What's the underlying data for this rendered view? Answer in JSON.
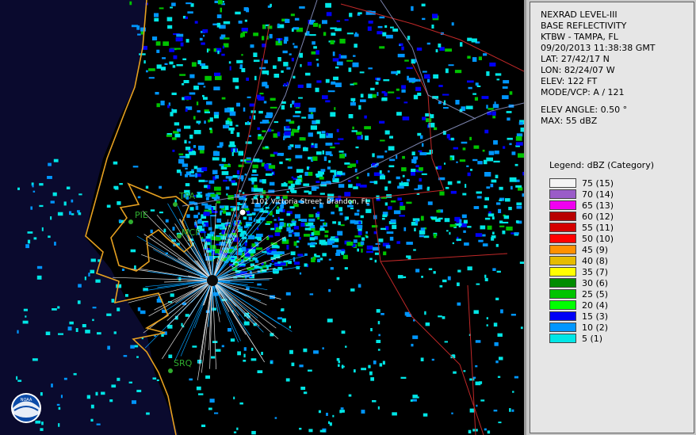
{
  "info": {
    "product": "NEXRAD LEVEL-III",
    "type": "BASE REFLECTIVITY",
    "station": "KTBW - TAMPA, FL",
    "datetime": "09/20/2013 11:38:38 GMT",
    "lat": "LAT: 27/42/17 N",
    "lon": "LON: 82/24/07 W",
    "elev": "ELEV: 122 FT",
    "mode": "MODE/VCP: A / 121",
    "elev_angle": "ELEV ANGLE: 0.50 °",
    "max": "MAX: 55 dBZ"
  },
  "legend": {
    "title": "Legend: dBZ (Category)",
    "items": [
      {
        "label": "75  (15)",
        "color": "#f4f4f4"
      },
      {
        "label": "70  (14)",
        "color": "#9a5cc8"
      },
      {
        "label": "65  (13)",
        "color": "#f000f0"
      },
      {
        "label": "60  (12)",
        "color": "#b80000"
      },
      {
        "label": "55  (11)",
        "color": "#d40000"
      },
      {
        "label": "50  (10)",
        "color": "#ff0000"
      },
      {
        "label": "45  (9)",
        "color": "#ff9000"
      },
      {
        "label": "40  (8)",
        "color": "#e6bc00"
      },
      {
        "label": "35  (7)",
        "color": "#ffff00"
      },
      {
        "label": "30  (6)",
        "color": "#008c00"
      },
      {
        "label": "25  (5)",
        "color": "#00c400"
      },
      {
        "label": "20  (4)",
        "color": "#00ff00"
      },
      {
        "label": "15  (3)",
        "color": "#0000f6"
      },
      {
        "label": "10  (2)",
        "color": "#0096ff"
      },
      {
        "label": "5  (1)",
        "color": "#00e6e6"
      }
    ]
  },
  "map": {
    "sites": {
      "tpa": "TPA",
      "pie": "PIE",
      "mcf": "MCF",
      "srq": "SRQ"
    },
    "address": "1101 Victoria Street, Brandon, FL"
  }
}
